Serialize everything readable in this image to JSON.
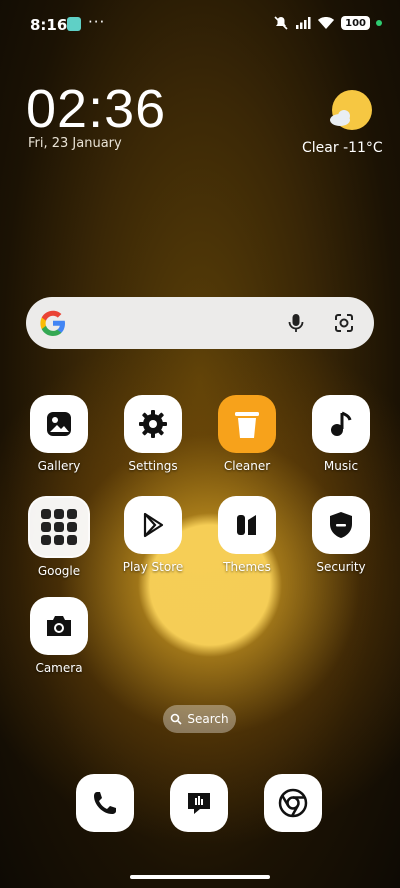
{
  "status_bar": {
    "time": "8:16",
    "more": "···",
    "battery": "100"
  },
  "widget": {
    "time": "02:36",
    "date": "Fri, 23 January",
    "weather": "Clear  -11°C"
  },
  "apps": [
    {
      "label": "Gallery"
    },
    {
      "label": "Settings"
    },
    {
      "label": "Cleaner"
    },
    {
      "label": "Music"
    },
    {
      "label": "Google"
    },
    {
      "label": "Play Store"
    },
    {
      "label": "Themes"
    },
    {
      "label": "Security"
    },
    {
      "label": "Camera"
    }
  ],
  "search_pill": {
    "label": "Search"
  },
  "colors": {
    "cleaner_tile": "#f7a21b",
    "sun": "#f6c742"
  }
}
